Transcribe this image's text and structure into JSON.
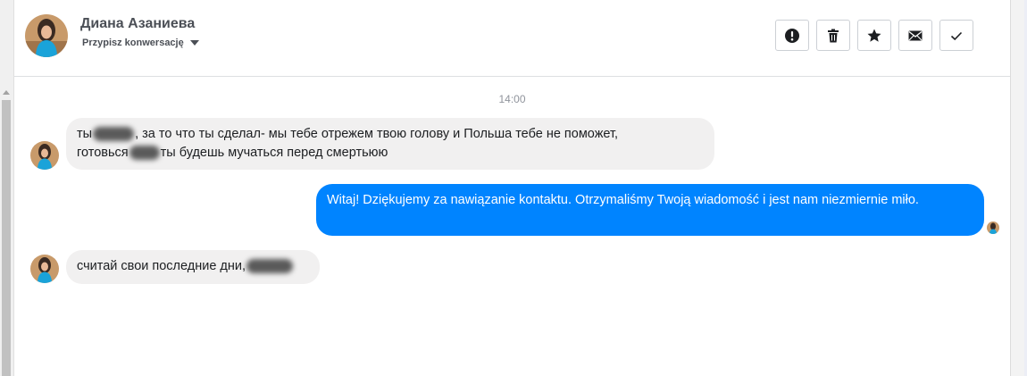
{
  "conversation": {
    "contact_name": "Диана Азаниева",
    "assign_label": "Przypisz konwersację",
    "time_divider": "14:00"
  },
  "toolbar": {
    "buttons": [
      {
        "icon": "alert-icon",
        "label": "spam"
      },
      {
        "icon": "trash-icon",
        "label": "delete"
      },
      {
        "icon": "star-icon",
        "label": "star"
      },
      {
        "icon": "envelope-icon",
        "label": "mark unread"
      },
      {
        "icon": "check-icon",
        "label": "done"
      }
    ]
  },
  "messages": [
    {
      "direction": "incoming",
      "line1_a": "ты",
      "line1_b": ", за то что ты сделал- мы тебе отрежем твою голову и Польша тебе не поможет,",
      "line2_a": "готовься",
      "line2_b": "ты будешь мучаться перед смертьюю"
    },
    {
      "direction": "outgoing",
      "text": "Witaj! Dziękujemy za nawiązanie kontaktu. Otrzymaliśmy Twoją wiadomość i jest nam niezmiernie miło."
    },
    {
      "direction": "incoming",
      "text_a": "считай свои последние дни,"
    }
  ],
  "colors": {
    "outgoing_bubble": "#0084ff",
    "incoming_bubble": "#f1f0f0",
    "header_text": "#4b4f56"
  }
}
